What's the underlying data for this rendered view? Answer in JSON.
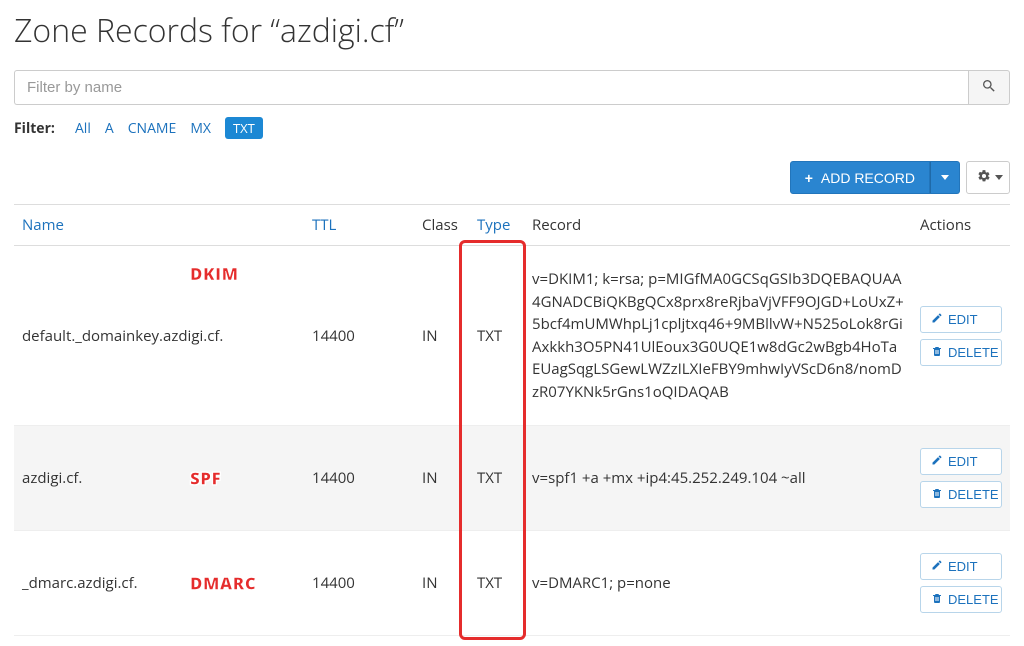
{
  "page_title": "Zone Records for “azdigi.cf”",
  "search": {
    "placeholder": "Filter by name"
  },
  "filter": {
    "label": "Filter:",
    "options": [
      "All",
      "A",
      "CNAME",
      "MX",
      "TXT"
    ],
    "active": "TXT"
  },
  "toolbar": {
    "add_label": "ADD RECORD"
  },
  "columns": {
    "name": "Name",
    "ttl": "TTL",
    "class": "Class",
    "type": "Type",
    "record": "Record",
    "actions": "Actions"
  },
  "actions": {
    "edit": "EDIT",
    "delete": "DELETE"
  },
  "records": [
    {
      "name": "default._domainkey.azdigi.cf.",
      "ttl": "14400",
      "class": "IN",
      "type": "TXT",
      "record": "v=DKIM1; k=rsa; p=MIGfMA0GCSqGSIb3DQEBAQUAA4GNADCBiQKBgQCx8prx8reRjbaVjVFF9OJGD+LoUxZ+5bcf4mUMWhpLj1cpljtxq46+9MBllvW+N525oLok8rGiAxkkh3O5PN41UlEoux3G0UQE1w8dGc2wBgb4HoTaEUagSqgLSGewLWZzILXIeFBY9mhwIyVScD6n8/nomDzR07YKNk5rGns1oQIDAQAB",
      "annotation": "DKIM"
    },
    {
      "name": "azdigi.cf.",
      "ttl": "14400",
      "class": "IN",
      "type": "TXT",
      "record": "v=spf1 +a +mx +ip4:45.252.249.104 ~all",
      "annotation": "SPF"
    },
    {
      "name": "_dmarc.azdigi.cf.",
      "ttl": "14400",
      "class": "IN",
      "type": "TXT",
      "record": "v=DMARC1; p=none",
      "annotation": "DMARC"
    }
  ]
}
